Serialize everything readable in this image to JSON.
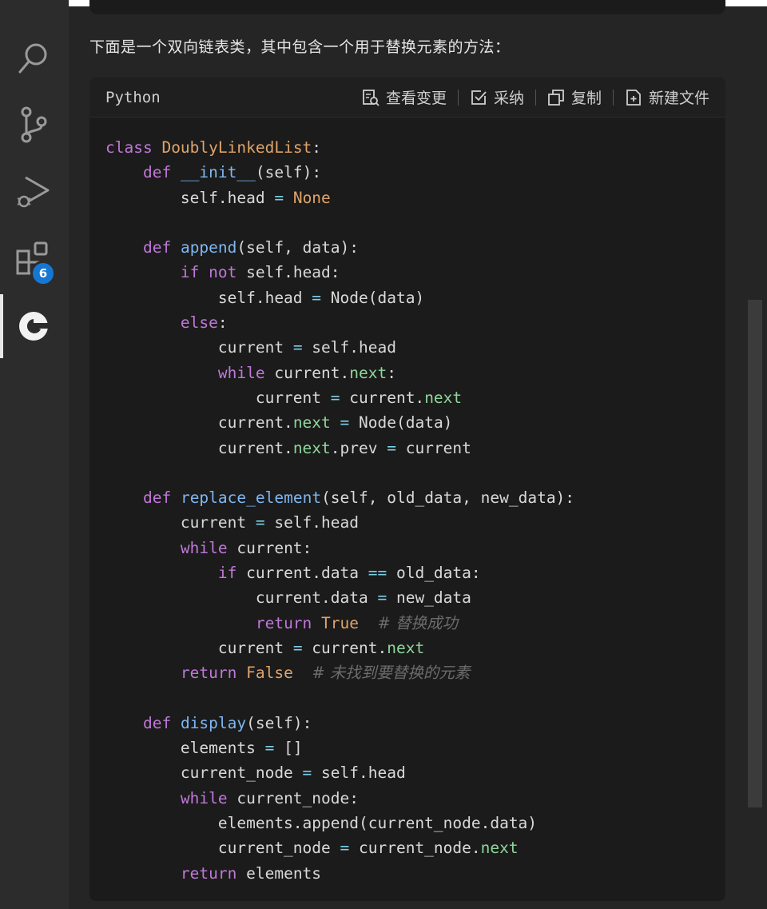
{
  "activity_bar": {
    "items": [
      "search-icon",
      "source-control-icon",
      "run-debug-icon",
      "extensions-icon",
      "assistant-icon"
    ],
    "extensions_badge": "6"
  },
  "chat": {
    "intro": "下面是一个双向链表类，其中包含一个用于替换元素的方法："
  },
  "code_block": {
    "language": "Python",
    "actions": {
      "view_changes": "查看变更",
      "accept": "采纳",
      "copy": "复制",
      "new_file": "新建文件"
    },
    "comment_success": "# 替换成功",
    "comment_not_found": "# 未找到要替换的元素"
  },
  "colors": {
    "background": "#252526",
    "code_background": "#1b1b1b",
    "keyword": "#c078d8",
    "function": "#7eb7f2",
    "builtin_constant": "#e0a46a",
    "property": "#8fd69b",
    "operator": "#7ccfe8",
    "badge": "#1677d2"
  }
}
